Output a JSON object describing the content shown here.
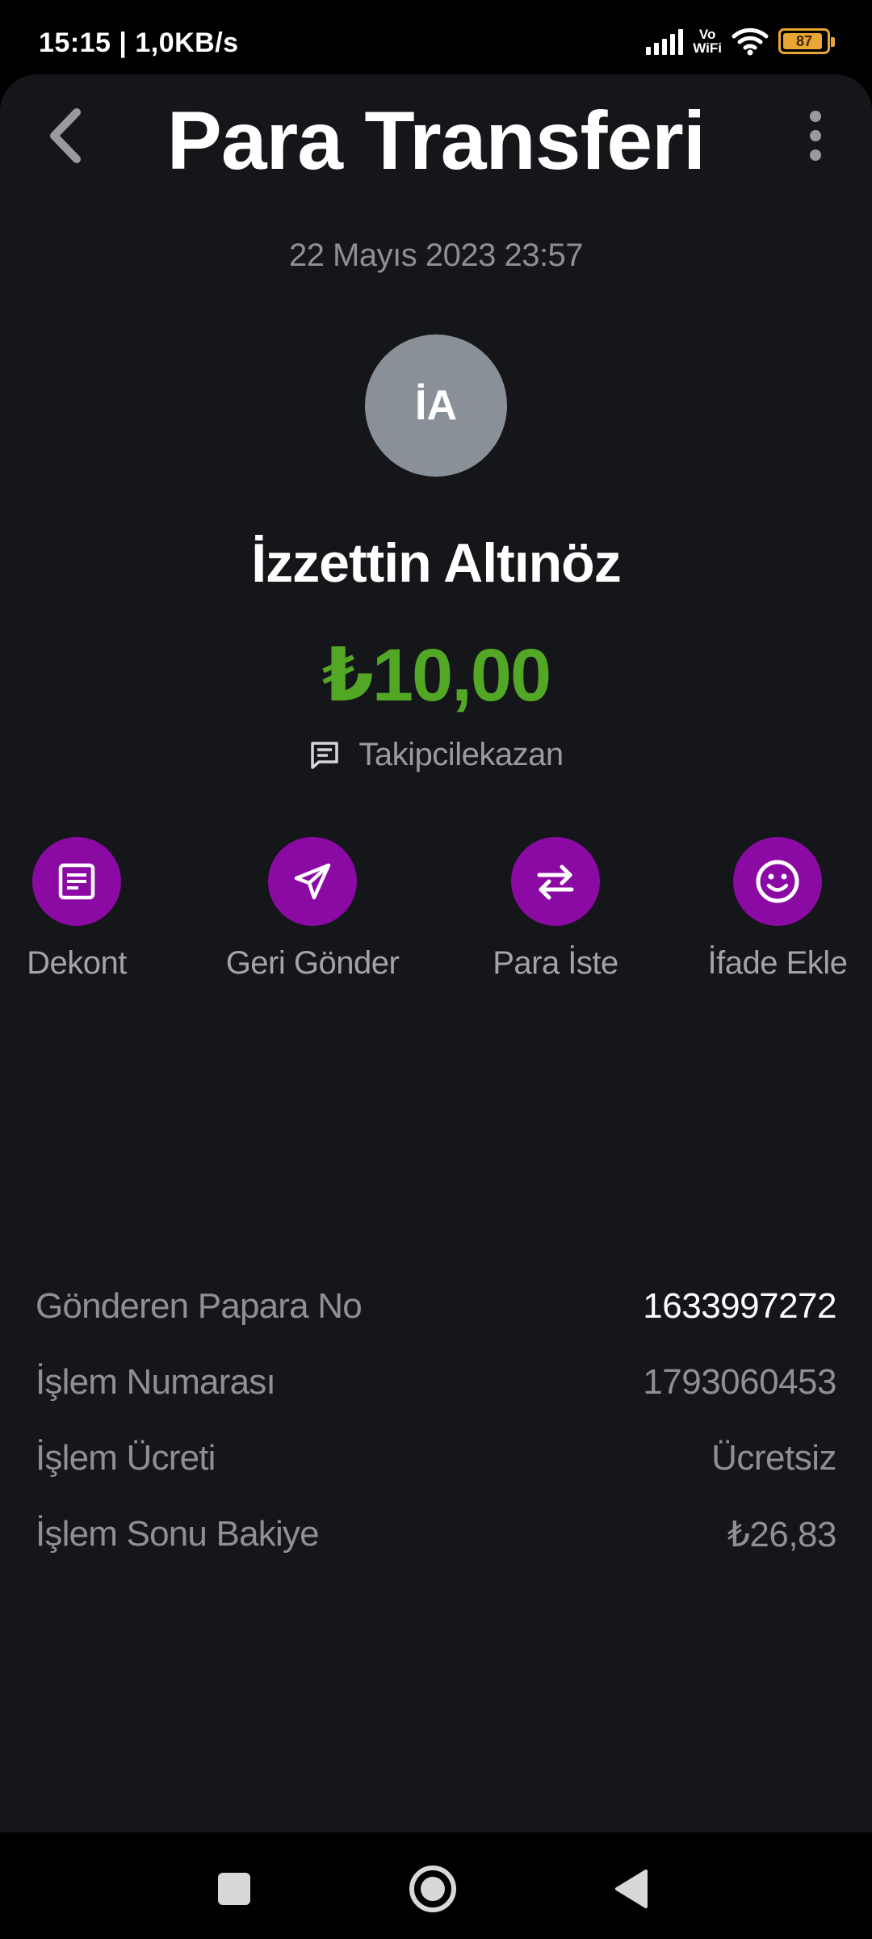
{
  "status_bar": {
    "time": "15:15 | 1,0KB/s",
    "vowifi_top": "Vo",
    "vowifi_bottom": "WiFi",
    "battery": "87",
    "icons": [
      "signal-icon",
      "vowifi-icon",
      "wifi-icon",
      "battery-icon"
    ],
    "battery_color": "#e8a634"
  },
  "header": {
    "title": "Para Transferi",
    "back_icon": "chevron-left-icon",
    "more_icon": "more-vertical-icon"
  },
  "transaction": {
    "date": "22 Mayıs 2023 23:57",
    "avatar_initials": "İA",
    "recipient_name": "İzzettin Altınöz",
    "amount": "₺10,00",
    "amount_color": "#52a824",
    "note_icon": "comment-icon",
    "note": "Takipcilekazan"
  },
  "actions": [
    {
      "label": "Dekont",
      "icon": "receipt-icon"
    },
    {
      "label": "Geri Gönder",
      "icon": "send-icon"
    },
    {
      "label": "Para İste",
      "icon": "swap-arrows-icon"
    },
    {
      "label": "İfade Ekle",
      "icon": "smiley-icon"
    }
  ],
  "action_color": "#8c0aa4",
  "details": [
    {
      "label": "Gönderen Papara No",
      "value": "1633997272"
    },
    {
      "label": "İşlem Numarası",
      "value": "1793060453"
    },
    {
      "label": "İşlem Ücreti",
      "value": "Ücretsiz"
    },
    {
      "label": "İşlem Sonu Bakiye",
      "value": "₺26,83"
    }
  ],
  "nav_bar": {
    "icons": [
      "recents-square-icon",
      "home-circle-icon",
      "back-triangle-icon"
    ]
  }
}
